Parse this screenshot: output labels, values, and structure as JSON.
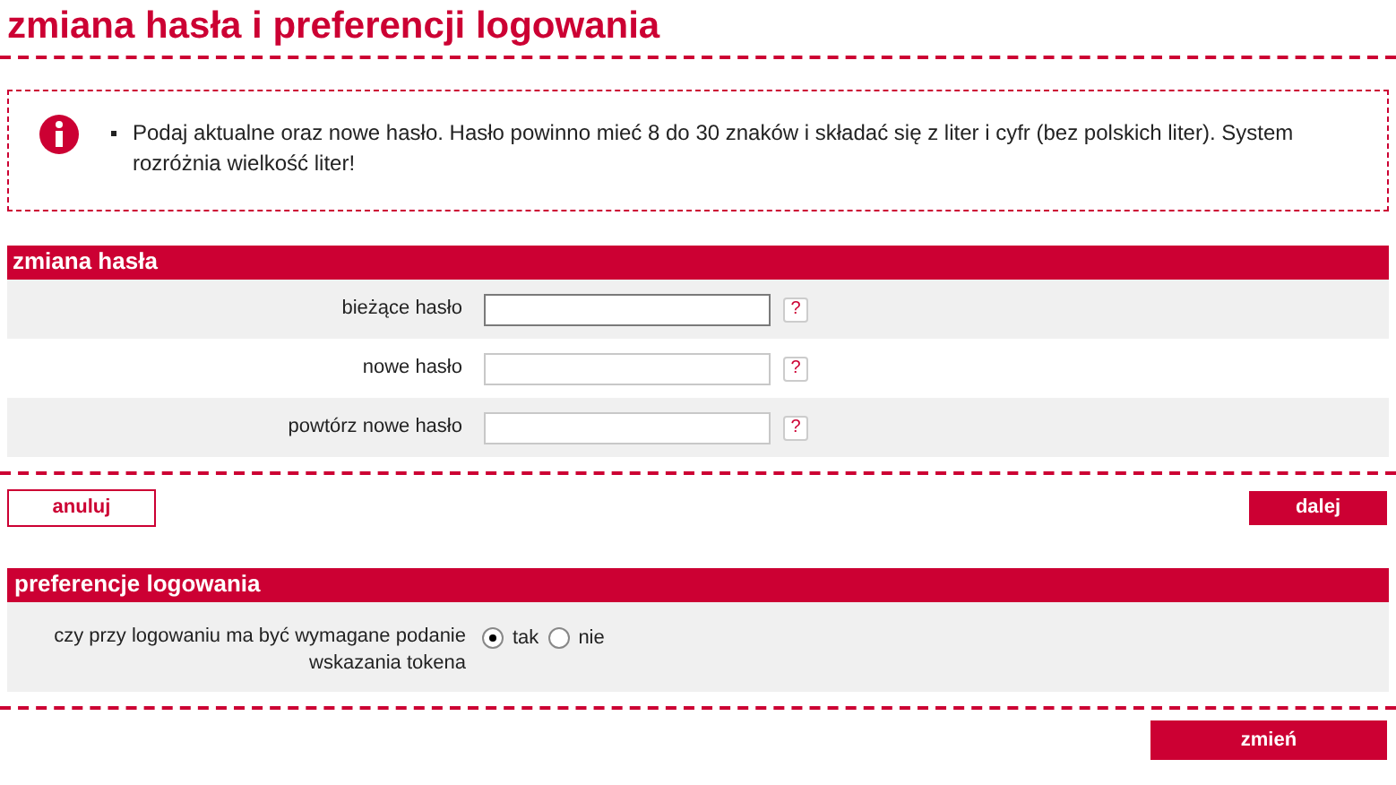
{
  "title": "zmiana hasła i preferencji logowania",
  "info": {
    "items": [
      "Podaj aktualne oraz nowe hasło. Hasło powinno mieć 8 do 30 znaków i składać się z liter i cyfr (bez polskich liter). System rozróżnia wielkość liter!"
    ]
  },
  "password_section": {
    "title": "zmiana hasła",
    "fields": [
      {
        "label": "bieżące hasło",
        "focused": true,
        "help": "?"
      },
      {
        "label": "nowe hasło",
        "focused": false,
        "help": "?"
      },
      {
        "label": "powtórz nowe hasło",
        "focused": false,
        "help": "?"
      }
    ]
  },
  "password_buttons": {
    "cancel": "anuluj",
    "next": "dalej"
  },
  "login_section": {
    "title": "preferencje logowania",
    "question": "czy przy logowaniu ma być wymagane podanie wskazania tokena",
    "options": [
      {
        "label": "tak",
        "selected": true
      },
      {
        "label": "nie",
        "selected": false
      }
    ]
  },
  "submit": "zmień"
}
